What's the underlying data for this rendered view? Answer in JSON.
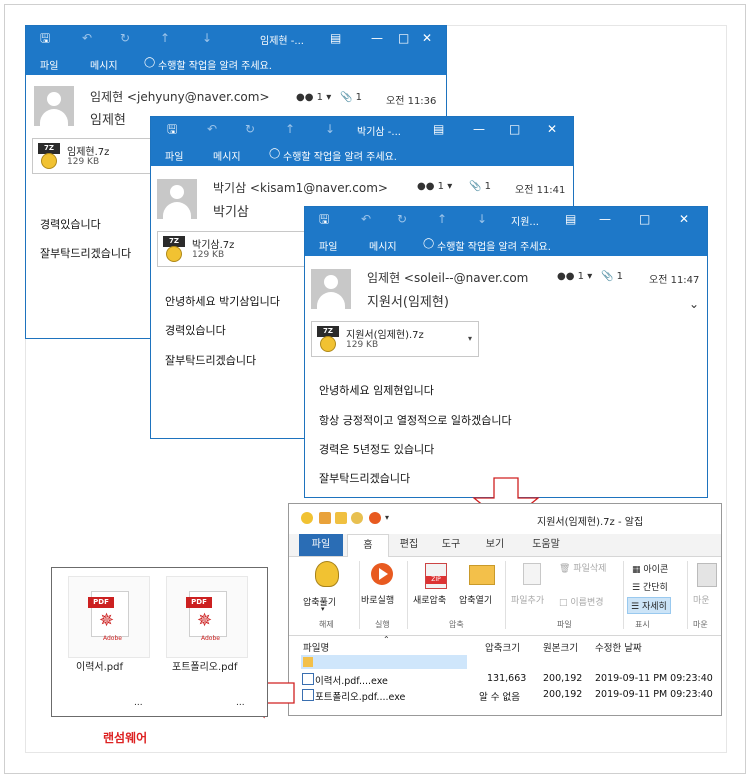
{
  "outlook_common": {
    "menu_file": "파일",
    "menu_message": "메시지",
    "tell_me": "수행할 작업을 알려 주세요."
  },
  "email1": {
    "window_title": "임제현 -...",
    "sender": "임제현 <jehyuny@naver.com>",
    "subject": "임제현",
    "people": "1",
    "attach_count": "1",
    "time": "오전 11:36",
    "attachment": {
      "name": "임제현.7z",
      "size": "129 KB"
    },
    "body": [
      "경력있습니다",
      "잘부탁드리겠습니다"
    ]
  },
  "email2": {
    "window_title": "박기삼 -...",
    "sender": "박기삼 <kisam1@naver.com>",
    "subject": "박기삼",
    "people": "1",
    "attach_count": "1",
    "time": "오전 11:41",
    "attachment": {
      "name": "박기삼.7z",
      "size": "129 KB"
    },
    "body": [
      "안녕하세요 박기삼입니다",
      "경력있습니다",
      "잘부탁드리겠습니다"
    ]
  },
  "email3": {
    "window_title": "지원...",
    "sender": "임제현 <soleil--@naver.com",
    "subject": "지원서(임제현)",
    "people": "1",
    "attach_count": "1",
    "time": "오전 11:47",
    "attachment": {
      "name": "지원서(임제현).7z",
      "size": "129 KB"
    },
    "body": [
      "안녕하세요 임제현입니다",
      "항상 긍정적이고 열정적으로 일하겠습니다",
      "경력은 5년정도 있습니다",
      "잘부탁드리겠습니다"
    ]
  },
  "zip": {
    "title": "지원서(임제현).7z - 알집",
    "tabs": [
      "파일",
      "홈",
      "편집",
      "도구",
      "보기",
      "도움말"
    ],
    "buttons": {
      "extract": "압축풀기",
      "run": "바로실행",
      "new_archive": "새로압축",
      "open_archive": "압축열기",
      "add_file": "파일추가",
      "delete_file": "파일삭제",
      "rename": "이름변경",
      "view_icon": "아이콘",
      "view_simple": "간단히",
      "view_detail": "자세히",
      "mount": "마운"
    },
    "groups": {
      "extract": "해제",
      "run": "실행",
      "archive": "압축",
      "file": "파일",
      "view": "표시",
      "mount": "마운"
    },
    "columns": [
      "파일명",
      "압축크기",
      "원본크기",
      "수정한 날짜"
    ],
    "rows": [
      {
        "name": "",
        "packed": "",
        "size": "",
        "date": ""
      },
      {
        "name": "이력서.pdf....exe",
        "packed": "131,663",
        "size": "200,192",
        "date": "2019-09-11 PM 09:23:40"
      },
      {
        "name": "포트폴리오.pdf....exe",
        "packed": "알 수 없음",
        "size": "200,192",
        "date": "2019-09-11 PM 09:23:40"
      }
    ]
  },
  "folder": {
    "files": [
      {
        "name": "이력서.pdf",
        "badge": "PDF",
        "brand": "Adobe"
      },
      {
        "name": "포트폴리오.pdf",
        "badge": "PDF",
        "brand": "Adobe"
      }
    ],
    "ellipsis": "..."
  },
  "caption": "랜섬웨어",
  "colors": {
    "outlook_blue": "#1e78c8",
    "zip_tab_blue": "#2a6db5",
    "ransom_red": "#dd2222",
    "pdf_red": "#cc2020"
  }
}
